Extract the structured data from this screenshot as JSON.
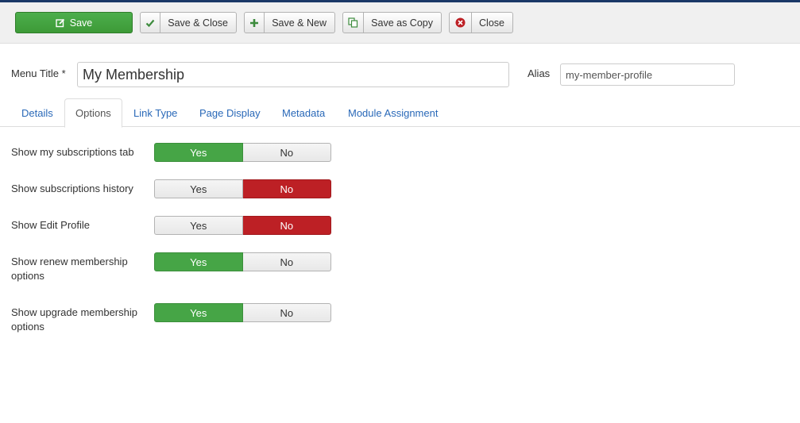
{
  "toolbar": {
    "save": "Save",
    "save_close": "Save & Close",
    "save_new": "Save & New",
    "save_copy": "Save as Copy",
    "close": "Close"
  },
  "form": {
    "menu_title_label": "Menu Title *",
    "menu_title_value": "My Membership",
    "alias_label": "Alias",
    "alias_value": "my-member-profile"
  },
  "tabs": [
    "Details",
    "Options",
    "Link Type",
    "Page Display",
    "Metadata",
    "Module Assignment"
  ],
  "active_tab": "Options",
  "toggle_labels": {
    "yes": "Yes",
    "no": "No"
  },
  "options": [
    {
      "label": "Show my subscriptions tab",
      "value": "Yes"
    },
    {
      "label": "Show subscriptions history",
      "value": "No"
    },
    {
      "label": "Show Edit Profile",
      "value": "No"
    },
    {
      "label": "Show renew membership options",
      "value": "Yes"
    },
    {
      "label": "Show upgrade membership options",
      "value": "Yes"
    }
  ],
  "colors": {
    "yes_active": "#46a546",
    "no_active": "#bd2025",
    "link": "#2a69b8",
    "header_bar": "#1a3867"
  }
}
